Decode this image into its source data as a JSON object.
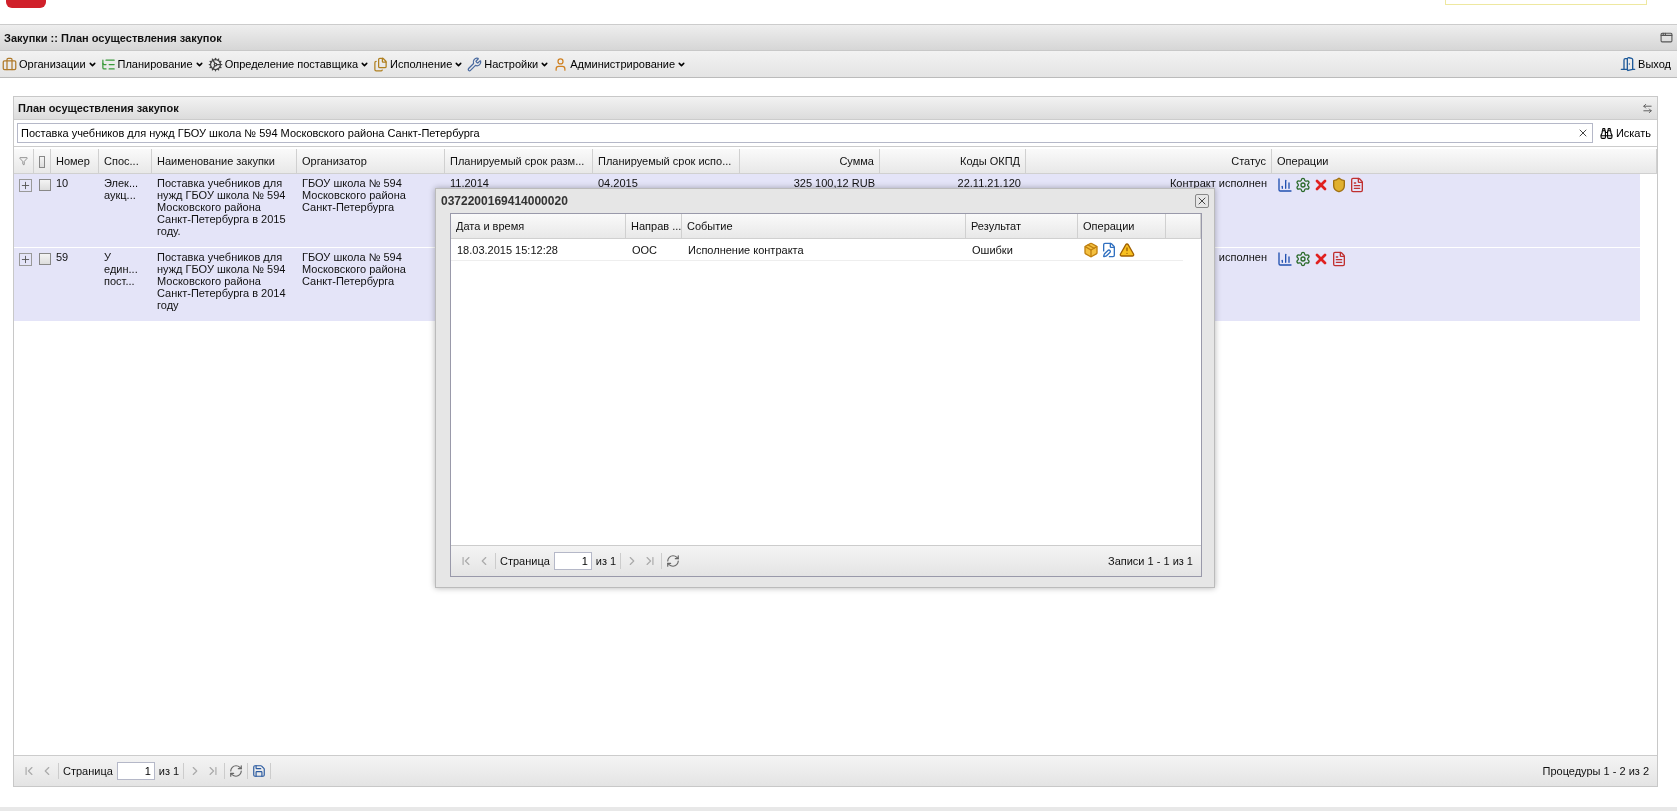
{
  "window": {
    "title": "Закупки :: План осуществления закупок"
  },
  "menu": [
    {
      "label": "Организации",
      "kind": "orgs"
    },
    {
      "label": "Планирование",
      "kind": "plan"
    },
    {
      "label": "Определение поставщика",
      "kind": "supplier"
    },
    {
      "label": "Исполнение",
      "kind": "exec"
    },
    {
      "label": "Настройки",
      "kind": "settings"
    },
    {
      "label": "Администрирование",
      "kind": "admin"
    }
  ],
  "exit": {
    "label": "Выход"
  },
  "panel": {
    "title": "План осуществления закупок",
    "search": {
      "value": "Поставка учебников для нужд ГБОУ школа № 594 Московского района Санкт-Петербурга"
    },
    "search_button": "Искать",
    "table": {
      "all_checked": false,
      "columns": [
        "Номер",
        "Спос...",
        "Наименование закупки",
        "Организатор",
        "Планируемый срок разм...",
        "Планируемый срок испо...",
        "Сумма",
        "Коды ОКПД",
        "Статус",
        "Операции"
      ],
      "rows": [
        {
          "selected": true,
          "checked": false,
          "number": "10",
          "method": [
            "Элек...",
            "аукц..."
          ],
          "name": "Поставка учебников для нужд ГБОУ школа № 594 Московского района Санкт-Петербурга в 2015 году.",
          "organizer": "ГБОУ школа № 594 Московского района Санкт-Петербурга",
          "placement": "11.2014",
          "execution": "04.2015",
          "sum": "325 100,12 RUB",
          "okpd": "22.11.21.120",
          "status": "Контракт исполнен",
          "operations": [
            {
              "kind": "chart"
            },
            {
              "kind": "gear"
            },
            {
              "kind": "delete"
            },
            {
              "kind": "emblem"
            },
            {
              "kind": "document"
            }
          ]
        },
        {
          "selected": true,
          "checked": false,
          "number": "59",
          "method": [
            "У",
            "един...",
            "пост..."
          ],
          "name": "Поставка учебников для нужд ГБОУ школа № 594 Московского района Санкт-Петербурга в 2014 году",
          "organizer": "ГБОУ школа № 594 Московского района Санкт-Петербурга",
          "status": "исполнен",
          "operations": [
            {
              "kind": "chart"
            },
            {
              "kind": "gear"
            },
            {
              "kind": "delete"
            },
            {
              "kind": "document"
            }
          ]
        }
      ]
    },
    "pager": {
      "page_label": "Страница",
      "page": "1",
      "of": "из 1",
      "summary": "Процедуры 1 - 2 из 2"
    }
  },
  "dialog": {
    "title": "0372200169414000020",
    "columns": [
      "Дата и время",
      "Направ ...",
      "Событие",
      "Результат",
      "Операции"
    ],
    "rows": [
      {
        "date": "18.03.2015 15:12:28",
        "direction": "ООС",
        "event": "Исполнение контракта",
        "result": "Ошибки",
        "operations": [
          {
            "kind": "package"
          },
          {
            "kind": "edit"
          },
          {
            "kind": "warning"
          }
        ]
      }
    ],
    "pager": {
      "page_label": "Страница",
      "page": "1",
      "of": "из 1",
      "summary": "Записи 1 - 1 из 1"
    }
  }
}
